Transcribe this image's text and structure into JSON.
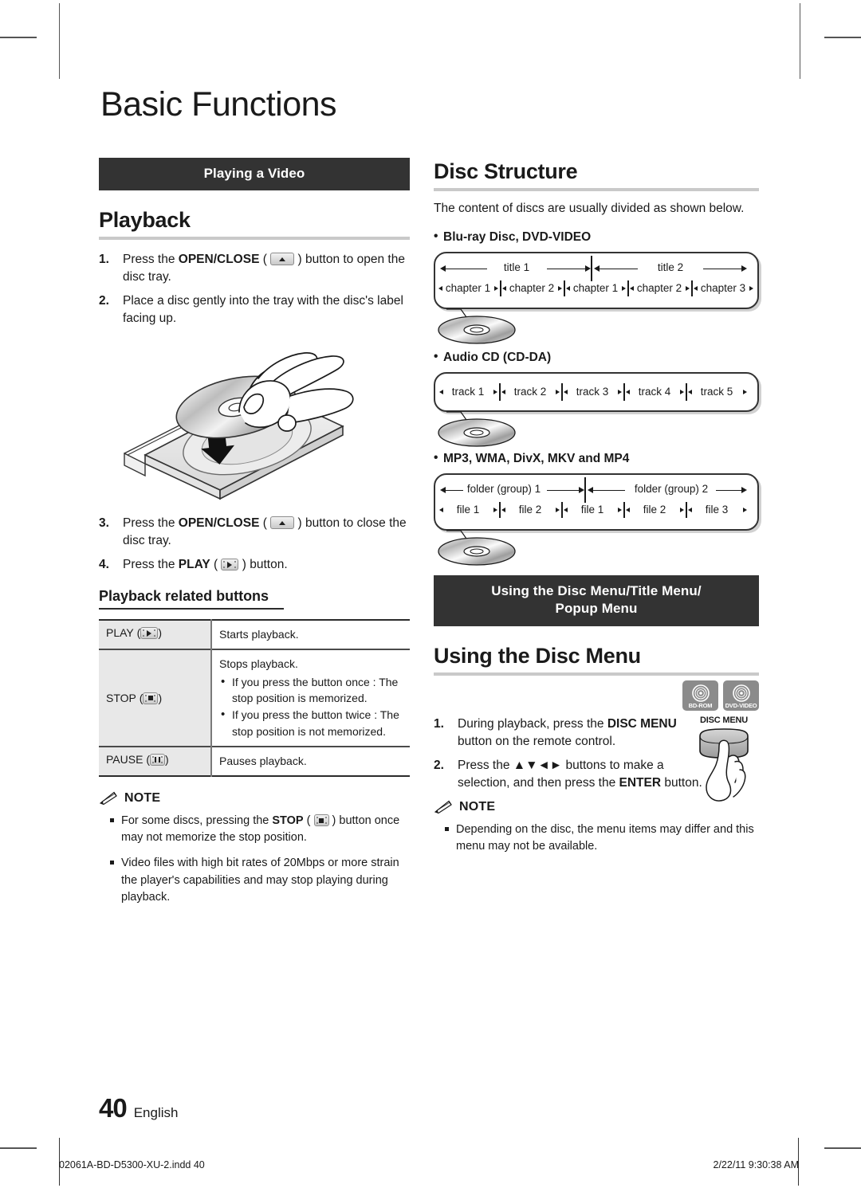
{
  "page": {
    "chapter_title": "Basic Functions",
    "page_number": "40",
    "language": "English",
    "print_file": "02061A-BD-D5300-XU-2.indd   40",
    "print_timestamp": "2/22/11   9:30:38 AM"
  },
  "left": {
    "banner": "Playing a Video",
    "playback_heading": "Playback",
    "steps": [
      {
        "num": "1.",
        "pre": "Press the ",
        "bold": "OPEN/CLOSE",
        "mid": " ( ",
        "key": "eject-key",
        "post": " ) button to open the disc tray."
      },
      {
        "num": "2.",
        "pre": "Place a disc gently into the tray with the disc's label facing up.",
        "bold": "",
        "mid": "",
        "key": "",
        "post": ""
      },
      {
        "num": "3.",
        "pre": "Press the ",
        "bold": "OPEN/CLOSE",
        "mid": " ( ",
        "key": "eject-key",
        "post": " ) button to close the disc tray."
      },
      {
        "num": "4.",
        "pre": "Press the ",
        "bold": "PLAY",
        "mid": " ( ",
        "key": "play-key",
        "post": " ) button."
      }
    ],
    "related_heading": "Playback related buttons",
    "table": {
      "rows": [
        {
          "key_label": "PLAY",
          "key_icon": "play-key",
          "desc_lines": [
            "Starts playback."
          ],
          "bullets": []
        },
        {
          "key_label": "STOP",
          "key_icon": "stop-key",
          "desc_lines": [
            "Stops playback."
          ],
          "bullets": [
            "If you press the button once : The stop position is memorized.",
            "If you press the button twice : The stop position is not memorized."
          ]
        },
        {
          "key_label": "PAUSE",
          "key_icon": "pause-key",
          "desc_lines": [
            "Pauses playback."
          ],
          "bullets": []
        }
      ]
    },
    "note": {
      "title": "NOTE",
      "items": [
        {
          "pre": "For some discs, pressing the ",
          "bold": "STOP",
          "mid": " ( ",
          "key": "stop-key",
          "post": " ) button once may not memorize the stop position."
        },
        {
          "pre": "Video files with high bit rates of 20Mbps or more strain the player's capabilities and may stop playing during playback.",
          "bold": "",
          "mid": "",
          "key": "",
          "post": ""
        }
      ]
    }
  },
  "right": {
    "disc_structure_heading": "Disc Structure",
    "disc_structure_intro": "The content of discs are usually divided as shown below.",
    "bluray_label": "Blu-ray Disc, DVD-VIDEO",
    "bluray_titles": [
      "title 1",
      "title 2"
    ],
    "bluray_chapters": [
      "chapter 1",
      "chapter 2",
      "chapter 1",
      "chapter 2",
      "chapter 3"
    ],
    "audiocd_label": "Audio CD (CD-DA)",
    "audiocd_tracks": [
      "track 1",
      "track 2",
      "track 3",
      "track 4",
      "track 5"
    ],
    "files_label": "MP3, WMA, DivX, MKV and MP4",
    "folders": [
      "folder (group) 1",
      "folder (group) 2"
    ],
    "files": [
      "file 1",
      "file 2",
      "file 1",
      "file 2",
      "file 3"
    ],
    "menu_banner_line1": "Using the Disc Menu/Title Menu/",
    "menu_banner_line2": "Popup Menu",
    "using_disc_menu_heading": "Using the Disc Menu",
    "badges": [
      "BD-ROM",
      "DVD-VIDEO"
    ],
    "remote_label": "DISC MENU",
    "steps": [
      {
        "num": "1.",
        "pre": "During playback, press the ",
        "bold": "DISC MENU",
        "post": " button on the remote control."
      },
      {
        "num": "2.",
        "pre": "Press the ▲▼◄► buttons to make a selection, and then press the ",
        "bold": "ENTER",
        "post": " button."
      }
    ],
    "note": {
      "title": "NOTE",
      "items": [
        {
          "pre": "Depending on the disc, the menu items may differ and this menu may not be available.",
          "bold": "",
          "post": ""
        }
      ]
    }
  },
  "colors": {
    "banner_bg": "#333333",
    "rule_gray": "#c9c9c9",
    "table_key_bg": "#e8e8e8",
    "badge_bg": "#8b8b8b"
  }
}
